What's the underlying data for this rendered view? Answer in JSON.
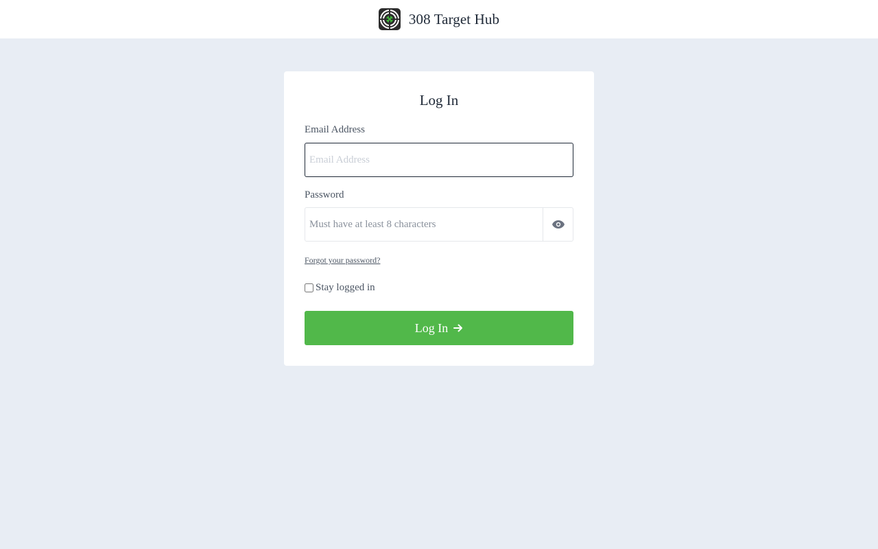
{
  "header": {
    "brand": "308 Target Hub",
    "logo_icon": "target-icon"
  },
  "login": {
    "title": "Log In",
    "email_label": "Email Address",
    "email_placeholder": "Email Address",
    "email_value": "",
    "password_label": "Password",
    "password_placeholder": "Must have at least 8 characters",
    "password_value": "",
    "toggle_icon": "eye-icon",
    "forgot_label": "Forgot your password?",
    "stay_logged_label": "Stay logged in",
    "stay_logged_checked": false,
    "submit_label": "Log In",
    "submit_icon": "arrow-right-icon"
  },
  "colors": {
    "background": "#e8edf4",
    "accent": "#51b84a",
    "text": "#1f2937"
  }
}
